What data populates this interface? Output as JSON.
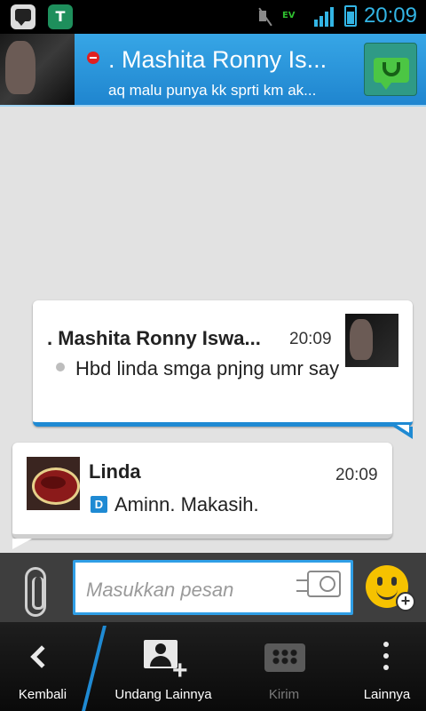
{
  "status_bar": {
    "time": "20:09",
    "network_label": "EV"
  },
  "header": {
    "contact_name": ". Mashita Ronny Is...",
    "contact_status": "aq malu punya kk sprti km ak..."
  },
  "messages": [
    {
      "sender": ". Mashita Ronny Iswa...",
      "time": "20:09",
      "text": "Hbd linda smga pnjng umr say"
    },
    {
      "sender": "Linda",
      "time": "20:09",
      "status_icon_text": "D",
      "text": "Aminn. Makasih."
    }
  ],
  "compose": {
    "placeholder": "Masukkan pesan",
    "emoji_plus": "+"
  },
  "action_bar": {
    "back_label": "Kembali",
    "invite_label": "Undang Lainnya",
    "invite_plus": "+",
    "send_label": "Kirim",
    "more_label": "Lainnya"
  },
  "colors": {
    "accent": "#1f8ad3",
    "header": "#2b96dc",
    "status_time": "#33b5e5"
  }
}
